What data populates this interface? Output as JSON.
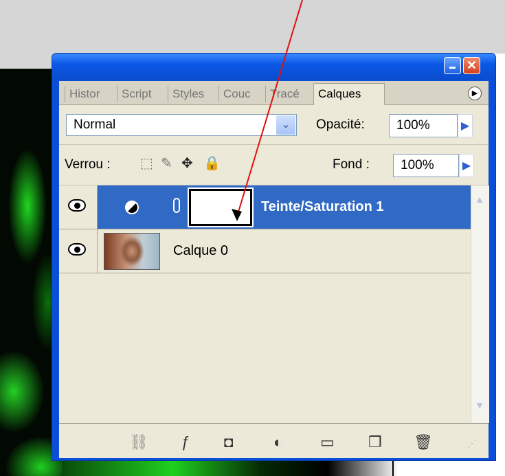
{
  "panel": {
    "tabs": [
      "Histor",
      "Script",
      "Styles",
      "Couc",
      "Tracé",
      "Calques"
    ],
    "active_tab": "Calques",
    "tab_menu_icon": "triangle-right"
  },
  "blend_mode": {
    "value": "Normal"
  },
  "opacity": {
    "label": "Opacité:",
    "value": "100%"
  },
  "lock": {
    "label": "Verrou :"
  },
  "fill": {
    "label": "Fond :",
    "value": "100%"
  },
  "layers": [
    {
      "name": "Teinte/Saturation 1",
      "selected": true,
      "visible": true
    },
    {
      "name": "Calque 0",
      "selected": false,
      "visible": true
    }
  ],
  "colors": {
    "selection": "#316ac5",
    "panel_bg": "#ece9d8",
    "titlebar": "#0b4fd8",
    "annotation_arrow": "#e01010"
  }
}
